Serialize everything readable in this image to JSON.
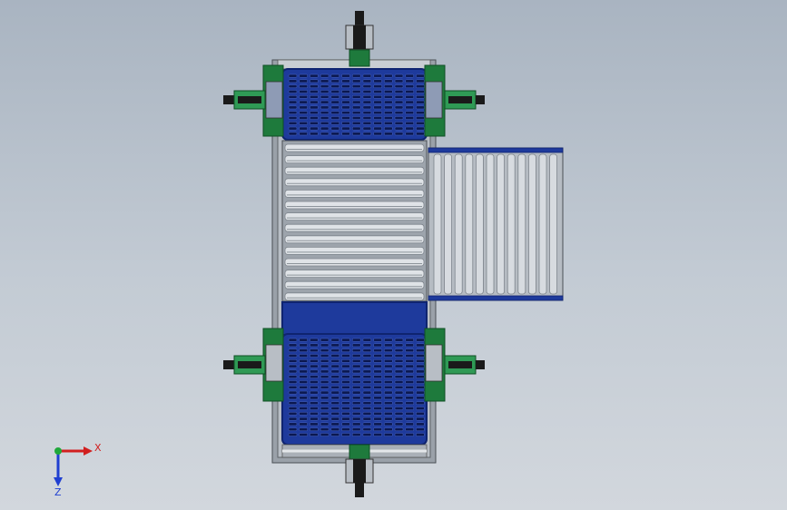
{
  "viewport": {
    "background_top": "#a9b4c1",
    "background_bottom": "#d2d7dd"
  },
  "model": {
    "colors": {
      "plate_blue": "#1e3a9c",
      "plate_blue_dark": "#0f2470",
      "slot_dark": "#0b1850",
      "bracket_green": "#1e7a3c",
      "bracket_green_dark": "#0f4f24",
      "frame_gray": "#8f969e",
      "roller_light": "#dfe3e7",
      "roller_dark": "#7c838b",
      "cylinder_black": "#1a1a1a",
      "cylinder_green": "#2f9a55"
    },
    "components": [
      "top-transfer-plate",
      "bottom-transfer-plate",
      "center-roller-conveyor",
      "side-roller-conveyor",
      "top-cylinder-assembly",
      "bottom-cylinder-assembly",
      "left-upper-cylinder",
      "right-upper-cylinder",
      "left-lower-cylinder",
      "right-lower-cylinder"
    ]
  },
  "triad": {
    "x_label": "X",
    "z_label": "Z",
    "x_color": "#d11f1f",
    "y_color": "#1fa83a",
    "z_color": "#1f3fd1"
  }
}
